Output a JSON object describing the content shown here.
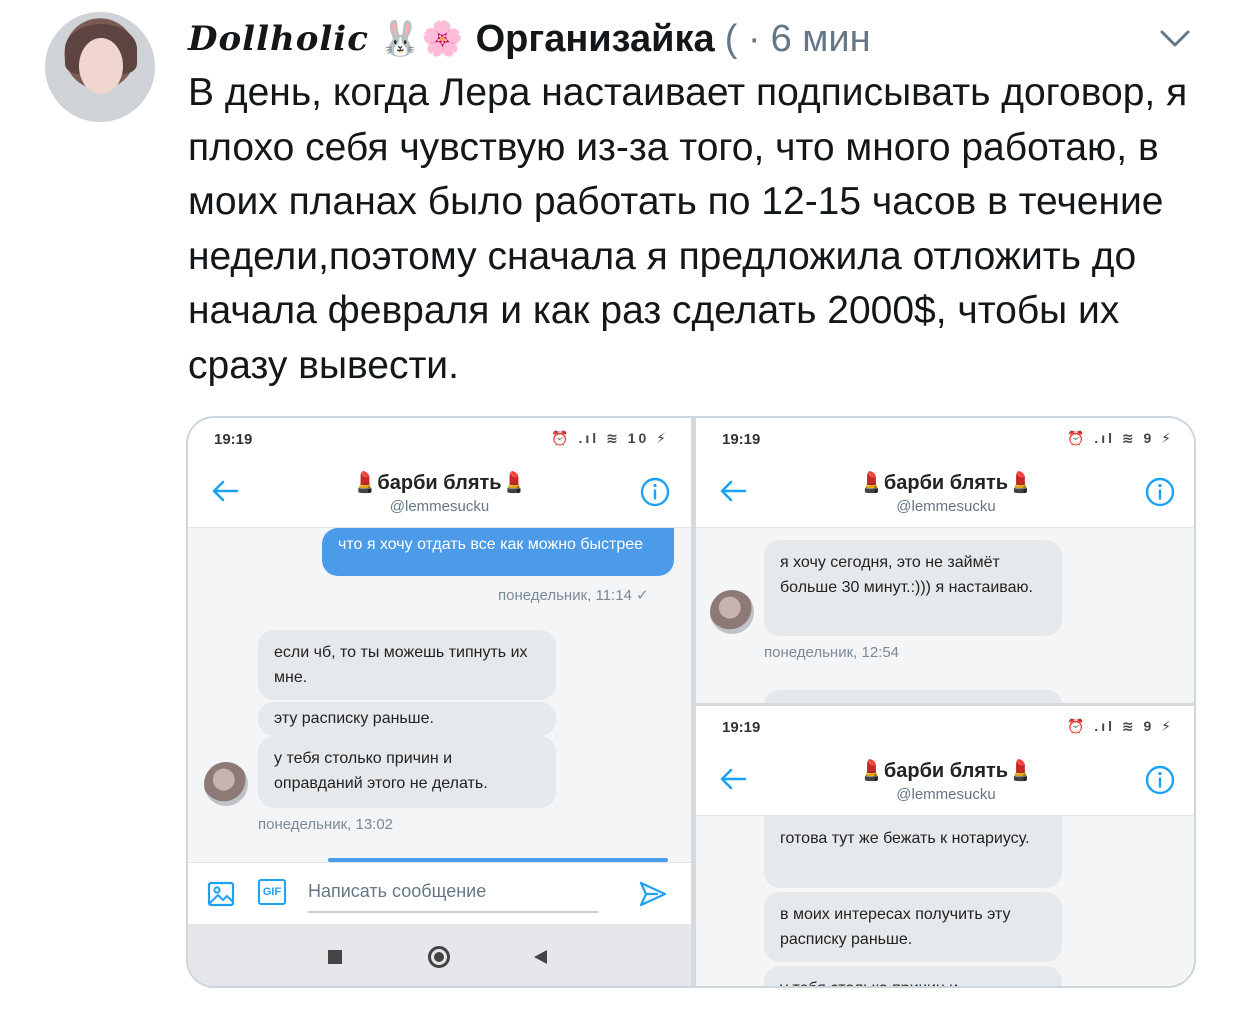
{
  "tweet": {
    "display_name": "Dollholic",
    "name_emoji": "🐰🌸",
    "author": "Организайка",
    "separator": "( ·",
    "time": "6 мин",
    "text": "В день, когда Лера настаивает подписывать договор, я плохо себя чувствую из-за того, что много работаю, в моих планах было работать по 12-15 часов в течение недели,поэтому сначала я предложила отложить до начала февраля и как раз сделать 2000$, чтобы их сразу вывести."
  },
  "screens": {
    "left": {
      "clock": "19:19",
      "status_icons": "⏰ .ıl ≋ 10 ⚡",
      "title": "💄барби блять💄",
      "handle": "@lemmesucku",
      "msg_out": "что я хочу отдать все как можно быстрее",
      "meta_out": "понедельник, 11:14 ✓",
      "msg_in_1": "если чб, то ты можешь типнуть их мне.",
      "msg_in_2": "эту расписку раньше.",
      "msg_in_3": "у тебя столько причин и оправданий этого не делать.",
      "meta_in": "понедельник, 13:02",
      "composer_placeholder": "Написать сообщение",
      "gif_label": "GIF"
    },
    "right_top": {
      "clock": "19:19",
      "status_icons": "⏰ .ıl ≋ 9 ⚡",
      "title": "💄барби блять💄",
      "handle": "@lemmesucku",
      "msg_in": "я хочу сегодня, это не займёт больше 30 минут.:))) я настаиваю.",
      "meta_in": "понедельник, 12:54"
    },
    "right_bottom": {
      "clock": "19:19",
      "status_icons": "⏰ .ıl ≋ 9 ⚡",
      "title": "💄барби блять💄",
      "handle": "@lemmesucku",
      "msg_in_1": "готова тут же бежать к нотариусу.",
      "msg_in_2": "в моих интересах получить эту расписку раньше.",
      "msg_in_3": "у тебя столько причин и"
    }
  }
}
